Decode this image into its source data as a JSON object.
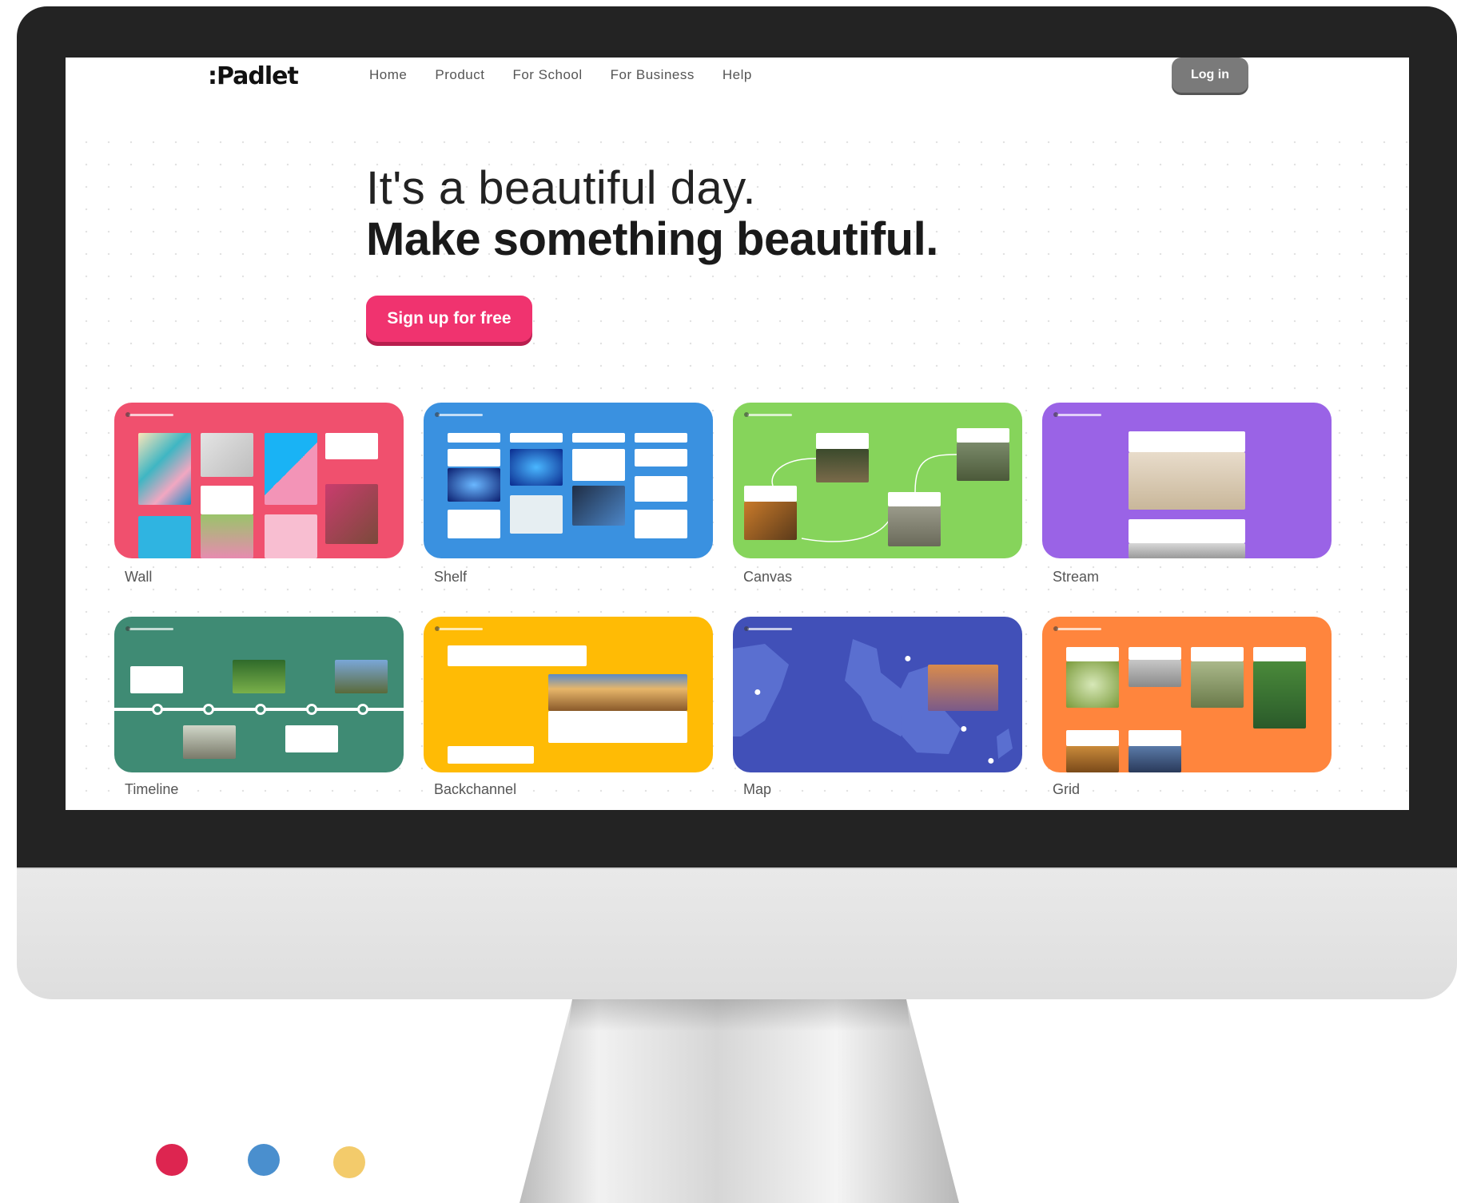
{
  "nav": {
    "logo": ":Padlet",
    "links": [
      "Home",
      "Product",
      "For School",
      "For Business",
      "Help"
    ],
    "login_label": "Log in"
  },
  "hero": {
    "line1": "It's a beautiful day.",
    "line2": "Make something beautiful.",
    "signup_label": "Sign up for free"
  },
  "formats": [
    {
      "label": "Wall",
      "color": "#f0506e"
    },
    {
      "label": "Shelf",
      "color": "#3a91e0"
    },
    {
      "label": "Canvas",
      "color": "#86d45b"
    },
    {
      "label": "Stream",
      "color": "#9a63e6"
    },
    {
      "label": "Timeline",
      "color": "#3f8b74"
    },
    {
      "label": "Backchannel",
      "color": "#ffbb05"
    },
    {
      "label": "Map",
      "color": "#4150b8"
    },
    {
      "label": "Grid",
      "color": "#ff853d"
    }
  ],
  "decor_dots": [
    "#dd2550",
    "#4a8fce",
    "#f3cb6b"
  ]
}
